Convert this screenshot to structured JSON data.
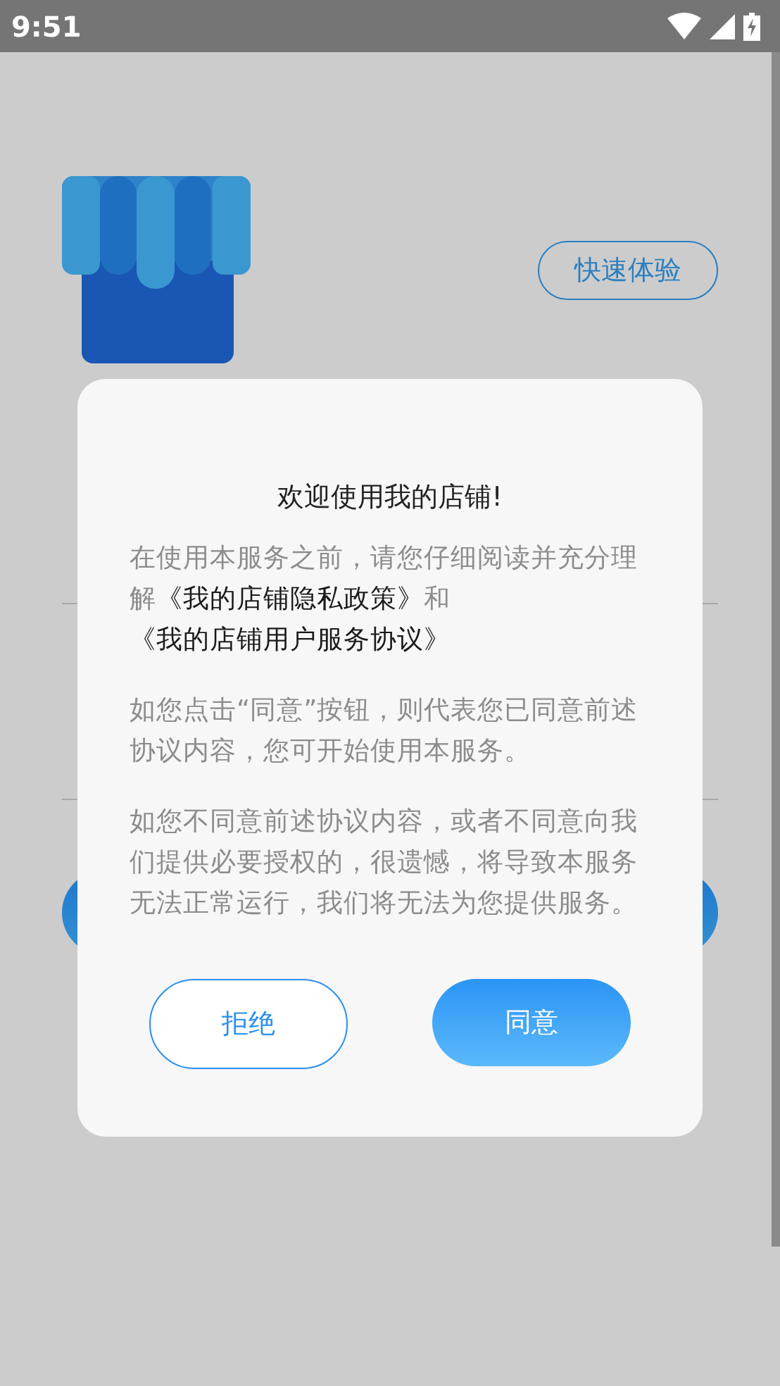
{
  "status_bar": {
    "time": "9:51"
  },
  "header": {
    "quick_button": "快速体验"
  },
  "dialog": {
    "title": "欢迎使用我的店铺!",
    "intro": [
      {
        "kind": "text",
        "text": "在使用本服务之前，请您仔细阅读并充分理解"
      },
      {
        "kind": "link",
        "text": "《我的店铺隐私政策》"
      },
      {
        "kind": "text",
        "text": "和"
      },
      {
        "kind": "link",
        "text": "《我的店铺用户服务协议》"
      }
    ],
    "paragraphs": [
      "如您点击“同意”按钮，则代表您已同意前述协议内容，您可开始使用本服务。",
      "如您不同意前述协议内容，或者不同意向我们提供必要授权的，很遗憾，将导致本服务无法正常运行，我们将无法为您提供服务。"
    ],
    "buttons": [
      {
        "label": "拒绝",
        "kind": "outline"
      },
      {
        "label": "同意",
        "kind": "filled"
      }
    ]
  }
}
